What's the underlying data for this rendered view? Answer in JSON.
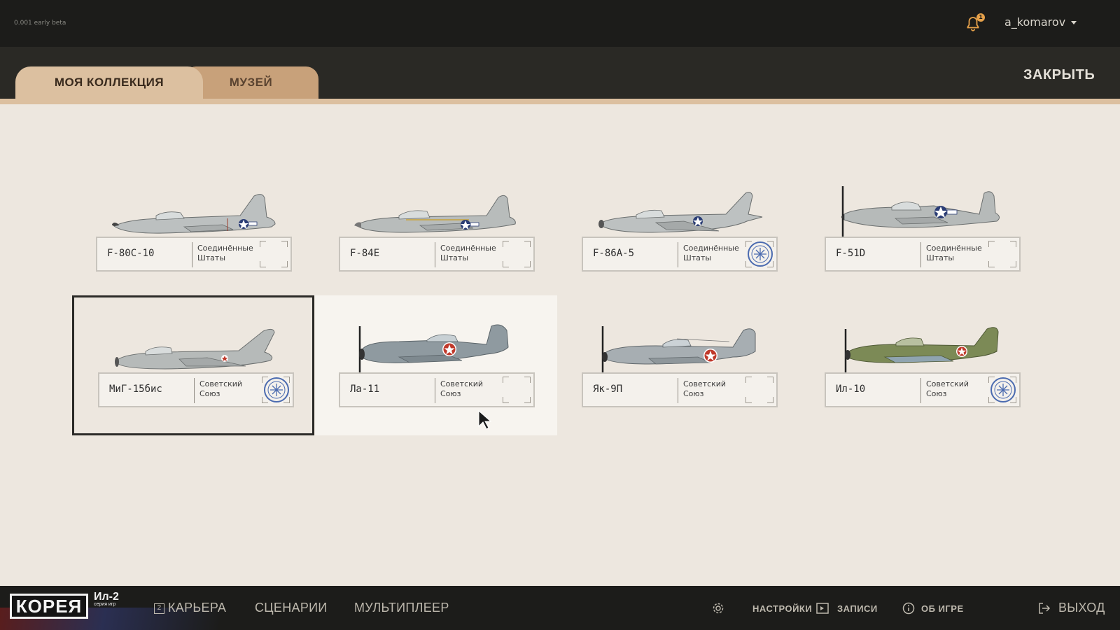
{
  "header": {
    "version": "0.001 early beta",
    "notification_count": "1",
    "username": "a_komarov",
    "icons": {
      "bell": "bell-icon",
      "caret": "chevron-down-icon"
    }
  },
  "tabs": [
    {
      "label": "МОЯ КОЛЛЕКЦИЯ",
      "active": true
    },
    {
      "label": "МУЗЕЙ",
      "active": false
    }
  ],
  "close_label": "ЗАКРЫТЬ",
  "colors": {
    "accent_tab": "#dcc0a0",
    "background": "#ede7df",
    "stamp": "#4b6bb0"
  },
  "aircraft": [
    {
      "name": "F-80C-10",
      "country_line1": "Соединённые",
      "country_line2": "Штаты",
      "stamped": false
    },
    {
      "name": "F-84E",
      "country_line1": "Соединённые",
      "country_line2": "Штаты",
      "stamped": false
    },
    {
      "name": "F-86A-5",
      "country_line1": "Соединённые",
      "country_line2": "Штаты",
      "stamped": true
    },
    {
      "name": "F-51D",
      "country_line1": "Соединённые",
      "country_line2": "Штаты",
      "stamped": false
    },
    {
      "name": "МиГ-15бис",
      "country_line1": "Советский",
      "country_line2": "Союз",
      "stamped": true,
      "selected": true
    },
    {
      "name": "Ла-11",
      "country_line1": "Советский",
      "country_line2": "Союз",
      "stamped": false,
      "hovered": true
    },
    {
      "name": "Як-9П",
      "country_line1": "Советский",
      "country_line2": "Союз",
      "stamped": false
    },
    {
      "name": "Ил-10",
      "country_line1": "Советский",
      "country_line2": "Союз",
      "stamped": true
    }
  ],
  "footer": {
    "logo": "КОРЕЯ",
    "logo_badge": "Ил-2",
    "logo_series": "серия игр",
    "nav": [
      "КАРЬЕРА",
      "СЦЕНАРИИ",
      "МУЛЬТИПЛЕЕР"
    ],
    "career_prefix": "2",
    "settings": "НАСТРОЙКИ",
    "records": "ЗАПИСИ",
    "about": "ОБ ИГРЕ",
    "exit": "ВЫХОД"
  }
}
